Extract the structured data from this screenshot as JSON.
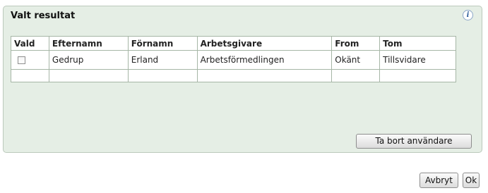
{
  "panel": {
    "title": "Valt resultat",
    "info_icon": "info-icon"
  },
  "table": {
    "columns": [
      "Vald",
      "Efternamn",
      "Förnamn",
      "Arbetsgivare",
      "From",
      "Tom"
    ],
    "rows": [
      {
        "selected": false,
        "efternamn": "Gedrup",
        "fornamn": "Erland",
        "arbetsgivare": "Arbetsförmedlingen",
        "from": "Okänt",
        "tom": "Tillsvidare"
      }
    ]
  },
  "buttons": {
    "remove_user": "Ta bort användare",
    "cancel": "Avbryt",
    "ok": "Ok"
  }
}
